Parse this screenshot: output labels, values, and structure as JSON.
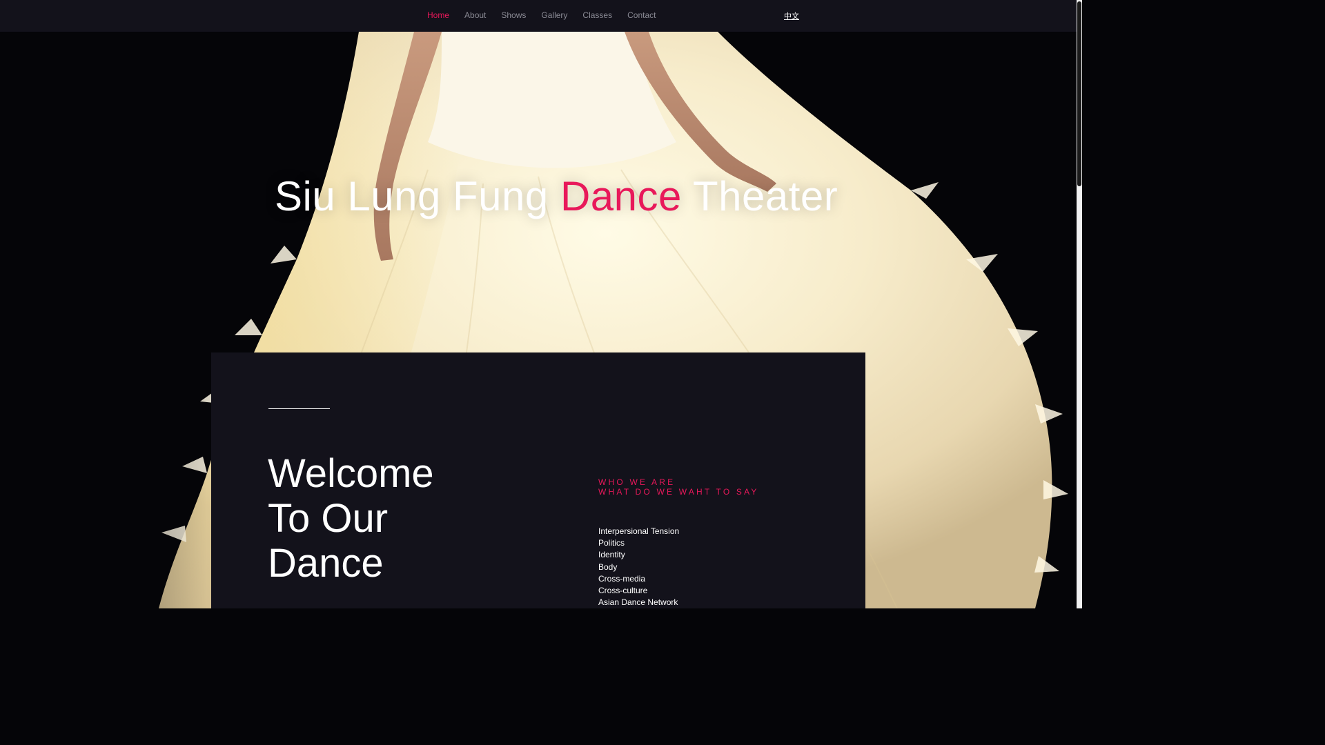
{
  "nav": {
    "items": [
      {
        "label": "Home",
        "active": true
      },
      {
        "label": "About"
      },
      {
        "label": "Shows"
      },
      {
        "label": "Gallery"
      },
      {
        "label": "Classes"
      },
      {
        "label": "Contact"
      }
    ],
    "language_link": "中文"
  },
  "hero": {
    "title_part1": "Siu Lung Fung ",
    "title_accent": "Dance",
    "title_part2": " Theater",
    "background_icon": "dancer-white-feather-dress-image"
  },
  "welcome": {
    "line1": "Welcome",
    "line2": "To Our",
    "line3": "Dance"
  },
  "tagline": {
    "line1": "WHO WE ARE",
    "line2": "WHAT DO WE WAHT TO SAY"
  },
  "topics": [
    "Interpersional Tension",
    "Politics",
    "Identity",
    "Body",
    "Cross-media",
    "Cross-culture",
    "Asian Dance Network"
  ],
  "colors": {
    "accent": "#e8185a",
    "panel": "#13121b",
    "nav_bg": "#13121b",
    "nav_text": "#8a8a94"
  }
}
